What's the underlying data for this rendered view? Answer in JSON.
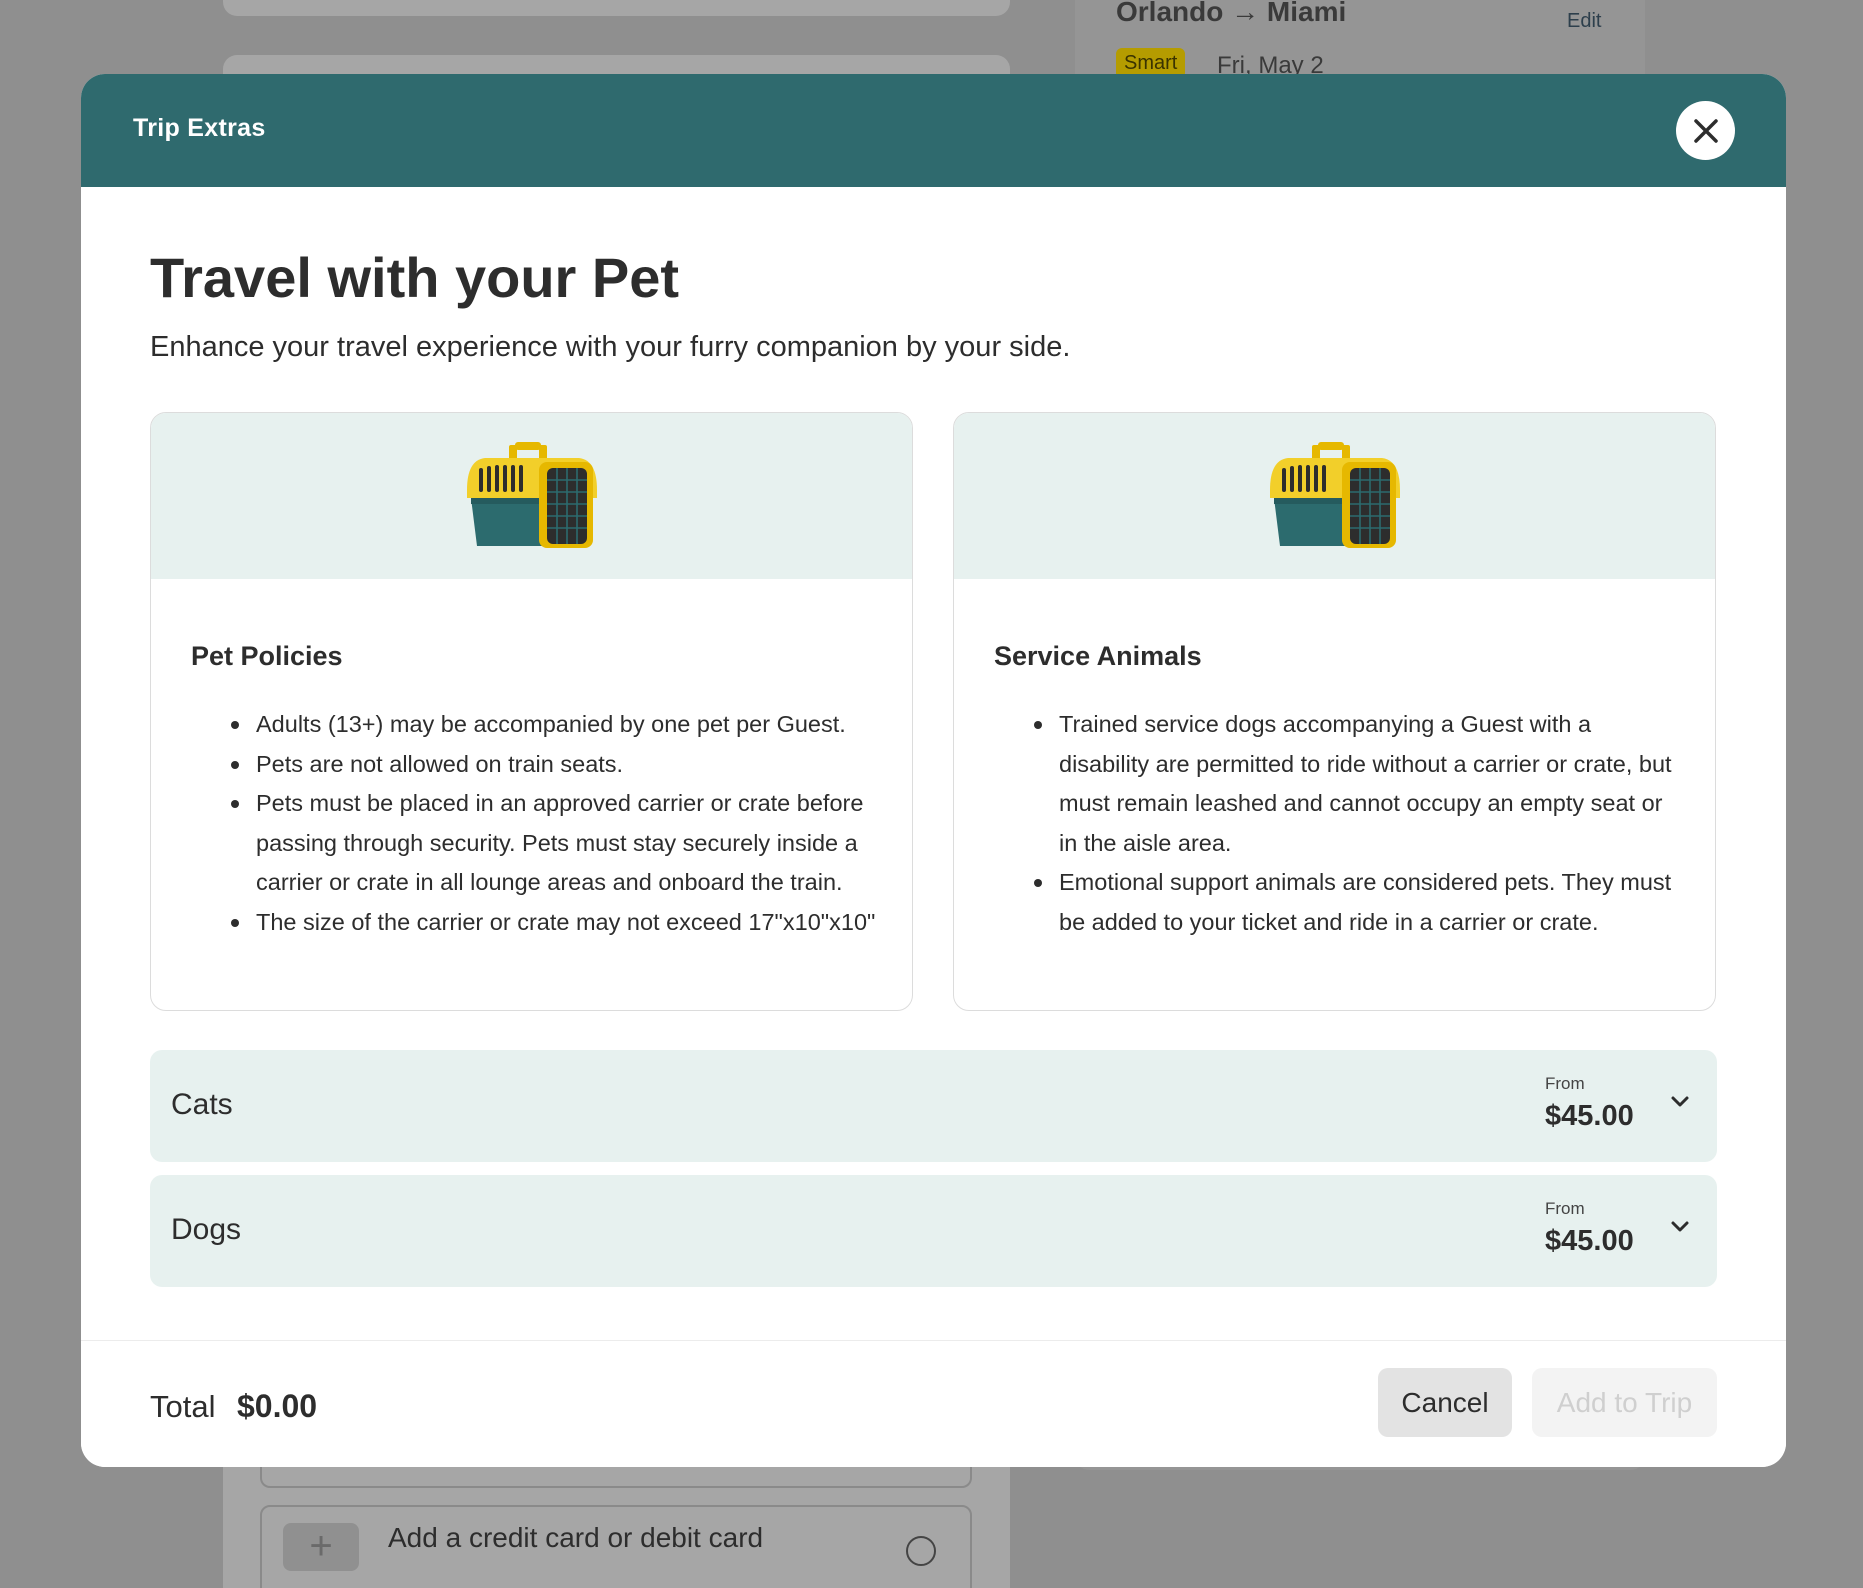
{
  "background": {
    "route_from": "Orlando",
    "route_arrow": "→",
    "route_to": "Miami",
    "edit_label": "Edit",
    "fare_badge": "Smart",
    "date": "Fri, May 2",
    "add_card_label": "Add a credit card or debit card",
    "add_icon": "plus-icon"
  },
  "modal": {
    "header_title": "Trip Extras",
    "close_icon": "close-icon",
    "title": "Travel with your Pet",
    "subtitle": "Enhance your travel experience with your furry companion by your side.",
    "cards": [
      {
        "icon": "pet-carrier-icon",
        "title": "Pet Policies",
        "items": [
          "Adults (13+) may be accompanied by one pet per Guest.",
          "Pets are not allowed on train seats.",
          "Pets must be placed in an approved carrier or crate before passing through security. Pets must stay securely inside a carrier or crate in all lounge areas and onboard the train.",
          "The size of the carrier or crate may not exceed 17\"x10\"x10\""
        ]
      },
      {
        "icon": "pet-carrier-icon",
        "title": "Service Animals",
        "items": [
          "Trained service dogs accompanying a Guest with a disability are permitted to ride without a carrier or crate, but must remain leashed and cannot occupy an empty seat or in the aisle area.",
          "Emotional support animals are considered pets. They must be added to your ticket and ride in a carrier or crate."
        ]
      }
    ],
    "pet_options": [
      {
        "name": "Cats",
        "from_label": "From",
        "price": "$45.00",
        "icon": "chevron-down-icon"
      },
      {
        "name": "Dogs",
        "from_label": "From",
        "price": "$45.00",
        "icon": "chevron-down-icon"
      }
    ],
    "footer": {
      "total_label": "Total",
      "total_value": "$0.00",
      "cancel_label": "Cancel",
      "add_label": "Add to Trip"
    }
  },
  "colors": {
    "header_bg": "#2f6a6e",
    "card_tint": "#e7f1ef",
    "carrier_yellow": "#f2cf2a",
    "carrier_teal": "#2c6b6e"
  }
}
